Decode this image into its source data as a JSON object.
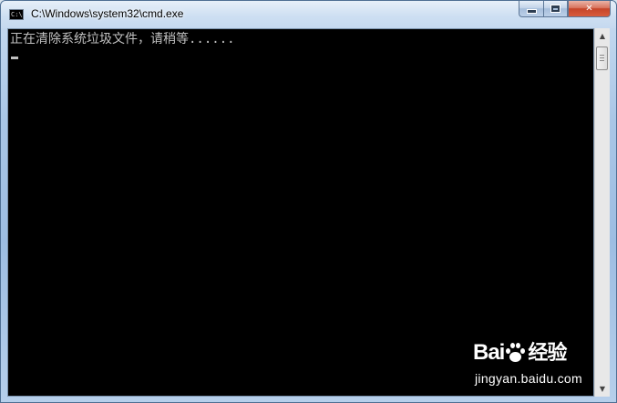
{
  "window": {
    "title": "C:\\Windows\\system32\\cmd.exe",
    "icon_label": "C:\\",
    "buttons": {
      "close_label": "✕"
    }
  },
  "console": {
    "lines": [
      "正在清除系统垃圾文件，请稍等......"
    ],
    "text_color": "#c0c0c0",
    "background_color": "#000000"
  },
  "scrollbar": {
    "up_arrow": "▲",
    "down_arrow": "▼"
  },
  "watermark": {
    "brand_prefix": "Bai",
    "brand_suffix": "经验",
    "url": "jingyan.baidu.com"
  },
  "colors": {
    "title_bar": "#b6cfeb",
    "close_button": "#c6452a"
  }
}
